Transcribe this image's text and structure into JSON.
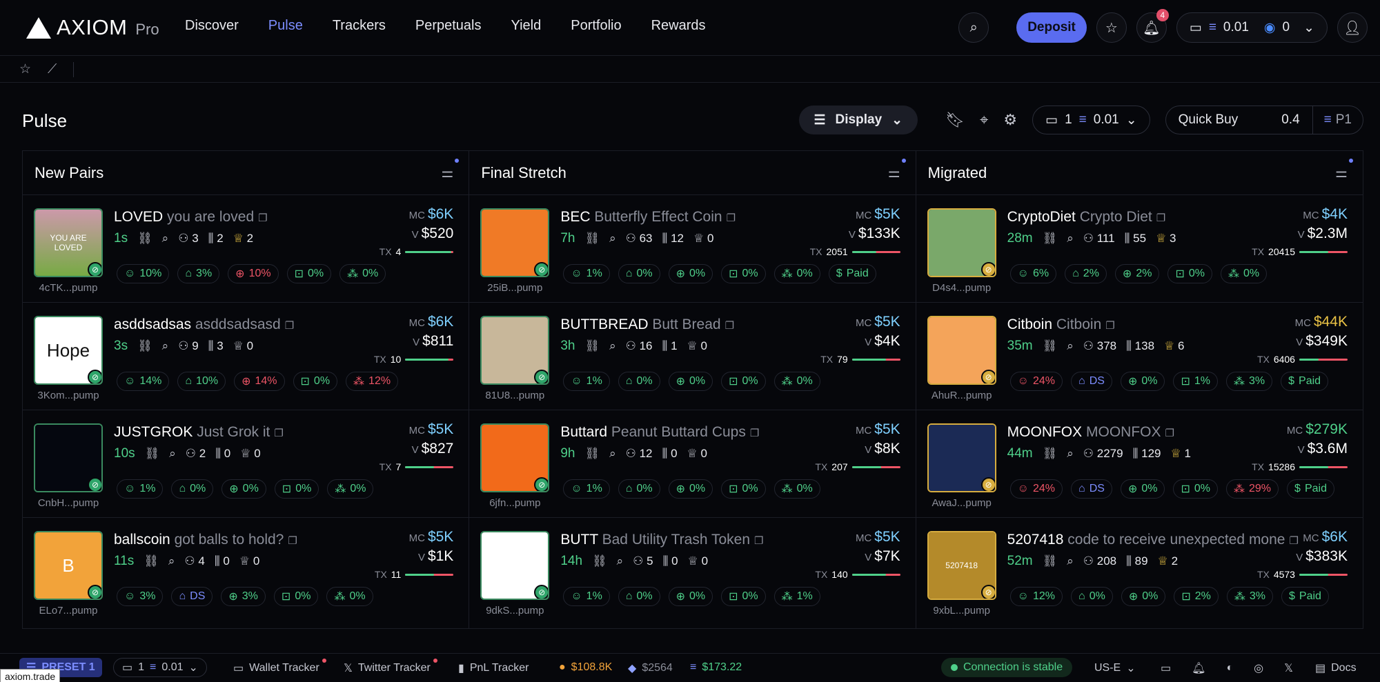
{
  "brand": {
    "name": "AXIOM",
    "suffix": "Pro"
  },
  "nav": [
    "Discover",
    "Pulse",
    "Trackers",
    "Perpetuals",
    "Yield",
    "Portfolio",
    "Rewards"
  ],
  "header": {
    "deposit": "Deposit",
    "notifications": "4",
    "sol_balance": "0.01",
    "usdc_balance": "0"
  },
  "page_title": "Pulse",
  "toolbar": {
    "display": "Display",
    "wallet_count": "1",
    "wallet_sol": "0.01",
    "quick_buy_label": "Quick Buy",
    "quick_buy_amount": "0.4",
    "preset": "P1"
  },
  "columns": [
    {
      "title": "New Pairs",
      "rows": [
        {
          "sym": "LOVED",
          "name": "you are loved",
          "addr": "4cTK...pump",
          "age": "1s",
          "holders": "3",
          "snipers": "2",
          "crowns": "2",
          "mc": "$6K",
          "v": "$520",
          "tx": "4",
          "stats": [
            "10%",
            "3%",
            "10%",
            "0%",
            "0%"
          ],
          "thumb_text": "YOU ARE LOVED"
        },
        {
          "sym": "asddsadsas",
          "name": "asddsadsasd",
          "addr": "3Kom...pump",
          "age": "3s",
          "holders": "9",
          "snipers": "3",
          "crowns": "0",
          "mc": "$6K",
          "v": "$811",
          "tx": "10",
          "stats": [
            "14%",
            "10%",
            "14%",
            "0%",
            "12%"
          ],
          "thumb_text": "Hope"
        },
        {
          "sym": "JUSTGROK",
          "name": "Just Grok it",
          "addr": "CnbH...pump",
          "age": "10s",
          "holders": "2",
          "snipers": "0",
          "crowns": "0",
          "mc": "$5K",
          "v": "$827",
          "tx": "7",
          "stats": [
            "1%",
            "0%",
            "0%",
            "0%",
            "0%"
          ],
          "thumb_text": ""
        },
        {
          "sym": "ballscoin",
          "name": "got balls to hold?",
          "addr": "ELo7...pump",
          "age": "11s",
          "holders": "4",
          "snipers": "0",
          "crowns": "0",
          "mc": "$5K",
          "v": "$1K",
          "tx": "11",
          "stats": [
            "3%",
            "DS",
            "3%",
            "0%",
            "0%"
          ],
          "thumb_text": "B"
        }
      ]
    },
    {
      "title": "Final Stretch",
      "rows": [
        {
          "sym": "BEC",
          "name": "Butterfly Effect Coin",
          "addr": "25iB...pump",
          "age": "7h",
          "holders": "63",
          "snipers": "12",
          "crowns": "0",
          "mc": "$5K",
          "v": "$133K",
          "tx": "2051",
          "stats": [
            "1%",
            "0%",
            "0%",
            "0%",
            "0%"
          ],
          "paid": "Paid"
        },
        {
          "sym": "BUTTBREAD",
          "name": "Butt Bread",
          "addr": "81U8...pump",
          "age": "3h",
          "holders": "16",
          "snipers": "1",
          "crowns": "0",
          "mc": "$5K",
          "v": "$4K",
          "tx": "79",
          "stats": [
            "1%",
            "0%",
            "0%",
            "0%",
            "0%"
          ]
        },
        {
          "sym": "Buttard",
          "name": "Peanut Buttard Cups",
          "addr": "6jfn...pump",
          "age": "9h",
          "holders": "12",
          "snipers": "0",
          "crowns": "0",
          "mc": "$5K",
          "v": "$8K",
          "tx": "207",
          "stats": [
            "1%",
            "0%",
            "0%",
            "0%",
            "0%"
          ]
        },
        {
          "sym": "BUTT",
          "name": "Bad Utility Trash Token",
          "addr": "9dkS...pump",
          "age": "14h",
          "holders": "5",
          "snipers": "0",
          "crowns": "0",
          "mc": "$5K",
          "v": "$7K",
          "tx": "140",
          "stats": [
            "1%",
            "0%",
            "0%",
            "0%",
            "1%"
          ]
        }
      ]
    },
    {
      "title": "Migrated",
      "rows": [
        {
          "sym": "CryptoDiet",
          "name": "Crypto Diet",
          "addr": "D4s4...pump",
          "age": "28m",
          "holders": "111",
          "snipers": "55",
          "crowns": "3",
          "mc": "$4K",
          "v": "$2.3M",
          "tx": "20415",
          "stats": [
            "6%",
            "2%",
            "2%",
            "0%",
            "0%"
          ]
        },
        {
          "sym": "Citboin",
          "name": "Citboin",
          "addr": "AhuR...pump",
          "age": "35m",
          "holders": "378",
          "snipers": "138",
          "crowns": "6",
          "mc": "$44K",
          "v": "$349K",
          "tx": "6406",
          "stats": [
            "24%",
            "DS",
            "0%",
            "1%",
            "3%"
          ],
          "paid": "Paid"
        },
        {
          "sym": "MOONFOX",
          "name": "MOONFOX",
          "addr": "AwaJ...pump",
          "age": "44m",
          "holders": "2279",
          "snipers": "129",
          "crowns": "1",
          "mc": "$279K",
          "v": "$3.6M",
          "tx": "15286",
          "stats": [
            "24%",
            "DS",
            "0%",
            "0%",
            "29%"
          ],
          "paid": "Paid"
        },
        {
          "sym": "5207418",
          "name": "code to receive unexpected mone",
          "addr": "9xbL...pump",
          "age": "52m",
          "holders": "208",
          "snipers": "89",
          "crowns": "2",
          "mc": "$6K",
          "v": "$383K",
          "tx": "4573",
          "stats": [
            "12%",
            "0%",
            "0%",
            "2%",
            "3%"
          ],
          "paid": "Paid",
          "thumb_text": "5207418"
        }
      ]
    }
  ],
  "bottom": {
    "preset": "PRESET 1",
    "wallet_count": "1",
    "wallet_sol": "0.01",
    "wallet_tracker": "Wallet Tracker",
    "twitter_tracker": "Twitter Tracker",
    "pnl_tracker": "PnL Tracker",
    "btc": "$108.8K",
    "eth": "$2564",
    "sol": "$173.22",
    "connection": "Connection is stable",
    "region": "US-E",
    "docs": "Docs"
  },
  "status_url": "axiom.trade"
}
